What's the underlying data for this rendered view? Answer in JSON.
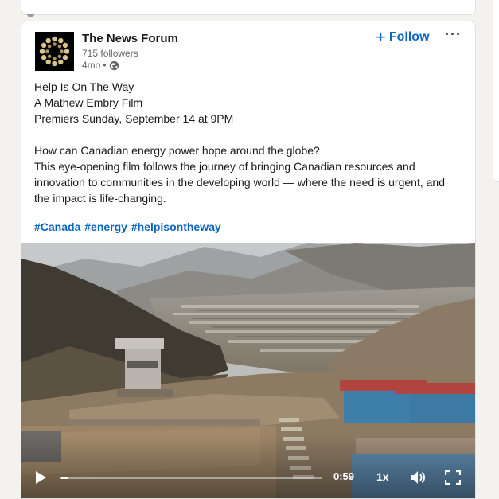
{
  "post": {
    "author": "The News Forum",
    "followers": "715 followers",
    "age": "4mo",
    "separator": "•",
    "follow_plus": "+",
    "follow_label": "Follow",
    "more_label": "···",
    "lines": [
      "Help Is On The Way",
      "A Mathew Embry Film",
      "Premiers Sunday, September 14 at 9PM"
    ],
    "paragraph": [
      "How can Canadian energy power hope around the globe?",
      "This eye-opening film follows the journey of bringing Canadian resources and",
      "innovation to communities in the developing world — where the need is urgent, and",
      "the impact is life-changing."
    ],
    "hashtags": [
      "#Canada",
      "#energy",
      "#helpisontheway"
    ]
  },
  "video": {
    "time": "0:59",
    "speed": "1x",
    "progress": 0.03
  },
  "icons": {
    "logo": "sunburst-logo",
    "visibility": "globe-icon",
    "play": "play-icon",
    "volume": "volume-icon",
    "fullscreen": "fullscreen-icon"
  },
  "colors": {
    "accent": "#0a66c2",
    "page_bg": "#f4f2ee",
    "card_bg": "#ffffff"
  }
}
